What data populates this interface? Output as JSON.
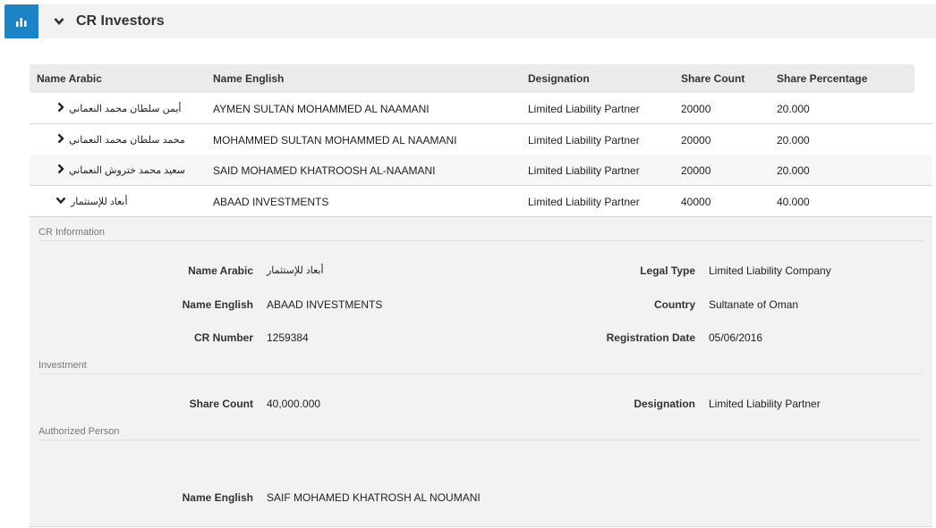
{
  "panel": {
    "title": "CR Investors",
    "chart_icon": "bar-chart-icon",
    "collapse_icon": "chevron-down-icon"
  },
  "table": {
    "columns": [
      "Name Arabic",
      "Name English",
      "Designation",
      "Share Count",
      "Share Percentage"
    ],
    "rows": [
      {
        "name_ar": "أيمن سلطان محمد النعماني",
        "name_en": "AYMEN SULTAN MOHAMMED AL NAAMANI",
        "designation": "Limited Liability Partner",
        "share_count": "20000",
        "share_pct": "20.000",
        "expanded": false
      },
      {
        "name_ar": "محمد سلطان محمد النعماني",
        "name_en": "MOHAMMED SULTAN MOHAMMED AL NAAMANI",
        "designation": "Limited Liability Partner",
        "share_count": "20000",
        "share_pct": "20.000",
        "expanded": false
      },
      {
        "name_ar": "سعيد محمد ختروش النعماني",
        "name_en": "SAID MOHAMED KHATROOSH AL-NAAMANI",
        "designation": "Limited Liability Partner",
        "share_count": "20000",
        "share_pct": "20.000",
        "expanded": false
      },
      {
        "name_ar": "أبعاد للإستثمار",
        "name_en": "ABAAD INVESTMENTS",
        "designation": "Limited Liability Partner",
        "share_count": "40000",
        "share_pct": "40.000",
        "expanded": true
      }
    ]
  },
  "details": {
    "cr_info": {
      "title": "CR Information",
      "name_arabic_label": "Name Arabic",
      "name_arabic_value": "أبعاد للإستثمار",
      "name_english_label": "Name English",
      "name_english_value": "ABAAD INVESTMENTS",
      "cr_number_label": "CR Number",
      "cr_number_value": "1259384",
      "legal_type_label": "Legal Type",
      "legal_type_value": "Limited Liability Company",
      "country_label": "Country",
      "country_value": "Sultanate of Oman",
      "reg_date_label": "Registration Date",
      "reg_date_value": "05/06/2016"
    },
    "investment": {
      "title": "Investment",
      "share_count_label": "Share Count",
      "share_count_value": "40,000.000",
      "designation_label": "Designation",
      "designation_value": "Limited Liability Partner"
    },
    "authorized": {
      "title": "Authorized Person",
      "name_english_label": "Name English",
      "name_english_value": "SAIF MOHAMED KHATROSH AL NOUMANI"
    }
  }
}
